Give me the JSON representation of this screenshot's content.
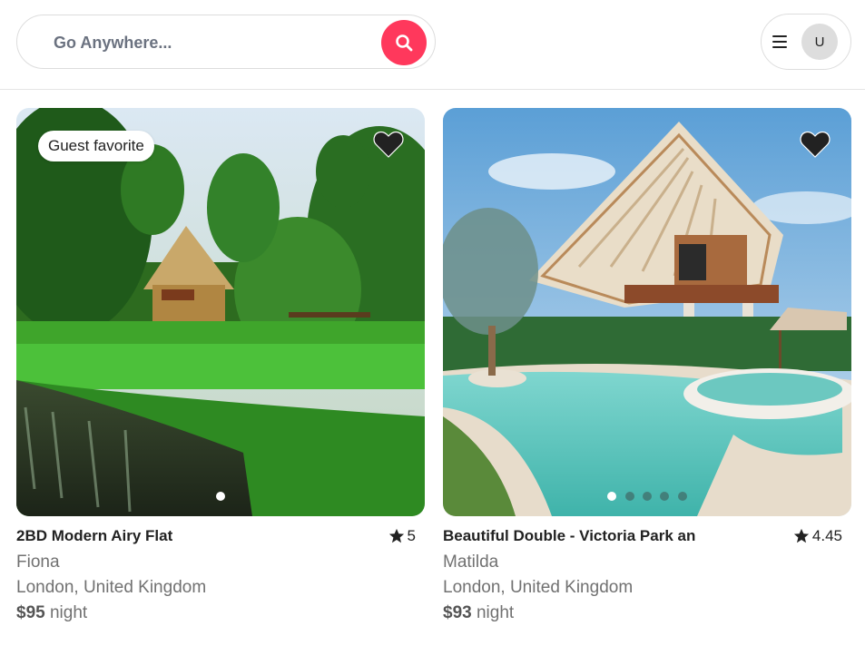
{
  "search": {
    "placeholder": "Go Anywhere..."
  },
  "user": {
    "initial": "U"
  },
  "listings": [
    {
      "badge": "Guest favorite",
      "title": "2BD Modern Airy Flat",
      "rating": "5",
      "host": "Fiona",
      "location": "London, United Kingdom",
      "price": "$95",
      "price_unit": "night",
      "photo_count": 1,
      "active_photo": 1
    },
    {
      "badge": "",
      "title": "Beautiful Double - Victoria Park an",
      "rating": "4.45",
      "host": "Matilda",
      "location": "London, United Kingdom",
      "price": "$93",
      "price_unit": "night",
      "photo_count": 5,
      "active_photo": 1
    }
  ],
  "colors": {
    "accent": "#ff385c",
    "text": "#222222",
    "muted": "#717171"
  },
  "icons": [
    "search-icon",
    "menu-icon",
    "heart-icon",
    "star-icon"
  ]
}
